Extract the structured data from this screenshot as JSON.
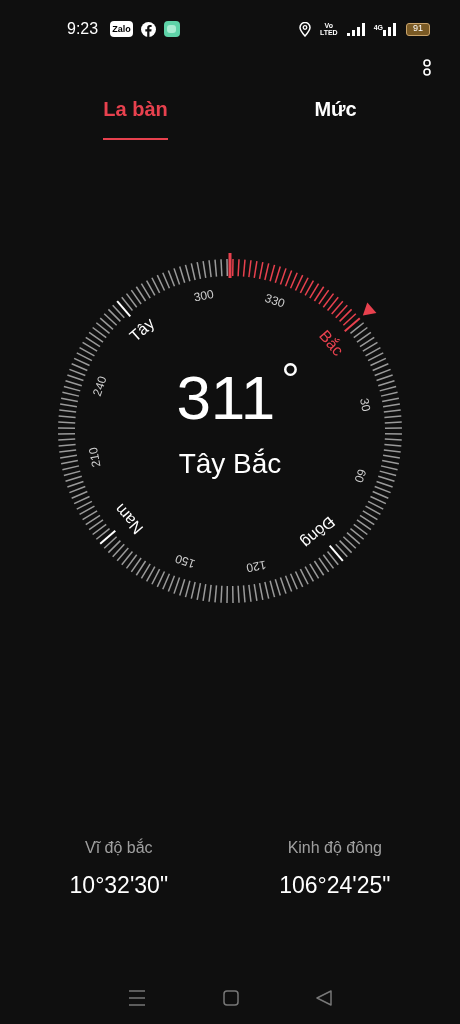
{
  "status_bar": {
    "time": "9:23",
    "app_icons": [
      "Zalo"
    ],
    "network": "4G",
    "volte": "Vo",
    "volte_sub": "LTED",
    "battery": "91"
  },
  "tabs": [
    {
      "label": "La bàn",
      "selected": true
    },
    {
      "label": "Mức",
      "selected": false
    }
  ],
  "compass": {
    "heading": "311",
    "degree_sign": "°",
    "direction": "Tây Bắc",
    "labels": [
      {
        "text": "Bắc",
        "kind": "cardinal",
        "color": "#e8414e"
      },
      {
        "text": "30",
        "kind": "degree",
        "color": "#cfcfcf"
      },
      {
        "text": "60",
        "kind": "degree",
        "color": "#cfcfcf"
      },
      {
        "text": "Đông",
        "kind": "cardinal",
        "color": "#ffffff"
      },
      {
        "text": "120",
        "kind": "degree",
        "color": "#cfcfcf"
      },
      {
        "text": "150",
        "kind": "degree",
        "color": "#cfcfcf"
      },
      {
        "text": "Nam",
        "kind": "cardinal",
        "color": "#ffffff"
      },
      {
        "text": "210",
        "kind": "degree",
        "color": "#cfcfcf"
      },
      {
        "text": "240",
        "kind": "degree",
        "color": "#cfcfcf"
      },
      {
        "text": "Tây",
        "kind": "cardinal",
        "color": "#ffffff"
      },
      {
        "text": "300",
        "kind": "degree",
        "color": "#cfcfcf"
      },
      {
        "text": "330",
        "kind": "degree",
        "color": "#cfcfcf"
      }
    ]
  },
  "coordinates": [
    {
      "label": "Vĩ độ bắc",
      "value": "10°32'30\""
    },
    {
      "label": "Kinh độ đông",
      "value": "106°24'25\""
    }
  ]
}
